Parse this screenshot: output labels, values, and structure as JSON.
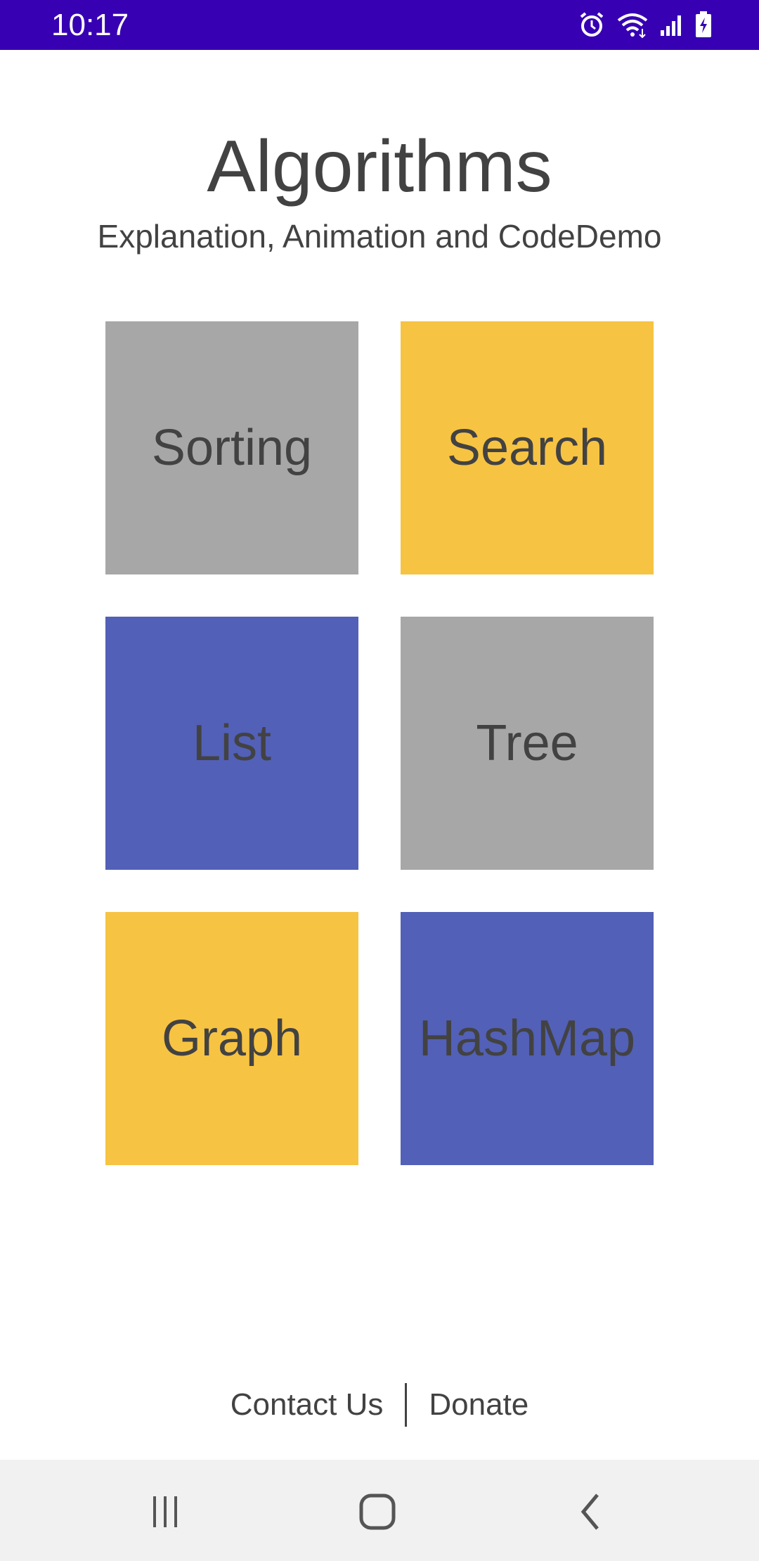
{
  "status_bar": {
    "time": "10:17",
    "icons": [
      "alarm-icon",
      "wifi-icon",
      "signal-icon",
      "battery-charging-icon"
    ],
    "background": "#3700b3"
  },
  "header": {
    "title": "Algorithms",
    "subtitle": "Explanation, Animation and CodeDemo"
  },
  "categories": [
    {
      "label": "Sorting",
      "color": "#a8a7a8"
    },
    {
      "label": "Search",
      "color": "#f7c342"
    },
    {
      "label": "List",
      "color": "#5260b7"
    },
    {
      "label": "Tree",
      "color": "#a8a7a8"
    },
    {
      "label": "Graph",
      "color": "#f7c342"
    },
    {
      "label": "HashMap",
      "color": "#5260b7"
    }
  ],
  "footer": {
    "contact_label": "Contact Us",
    "donate_label": "Donate"
  },
  "nav_bar": {
    "buttons": [
      "recents-icon",
      "home-icon",
      "back-icon"
    ]
  }
}
